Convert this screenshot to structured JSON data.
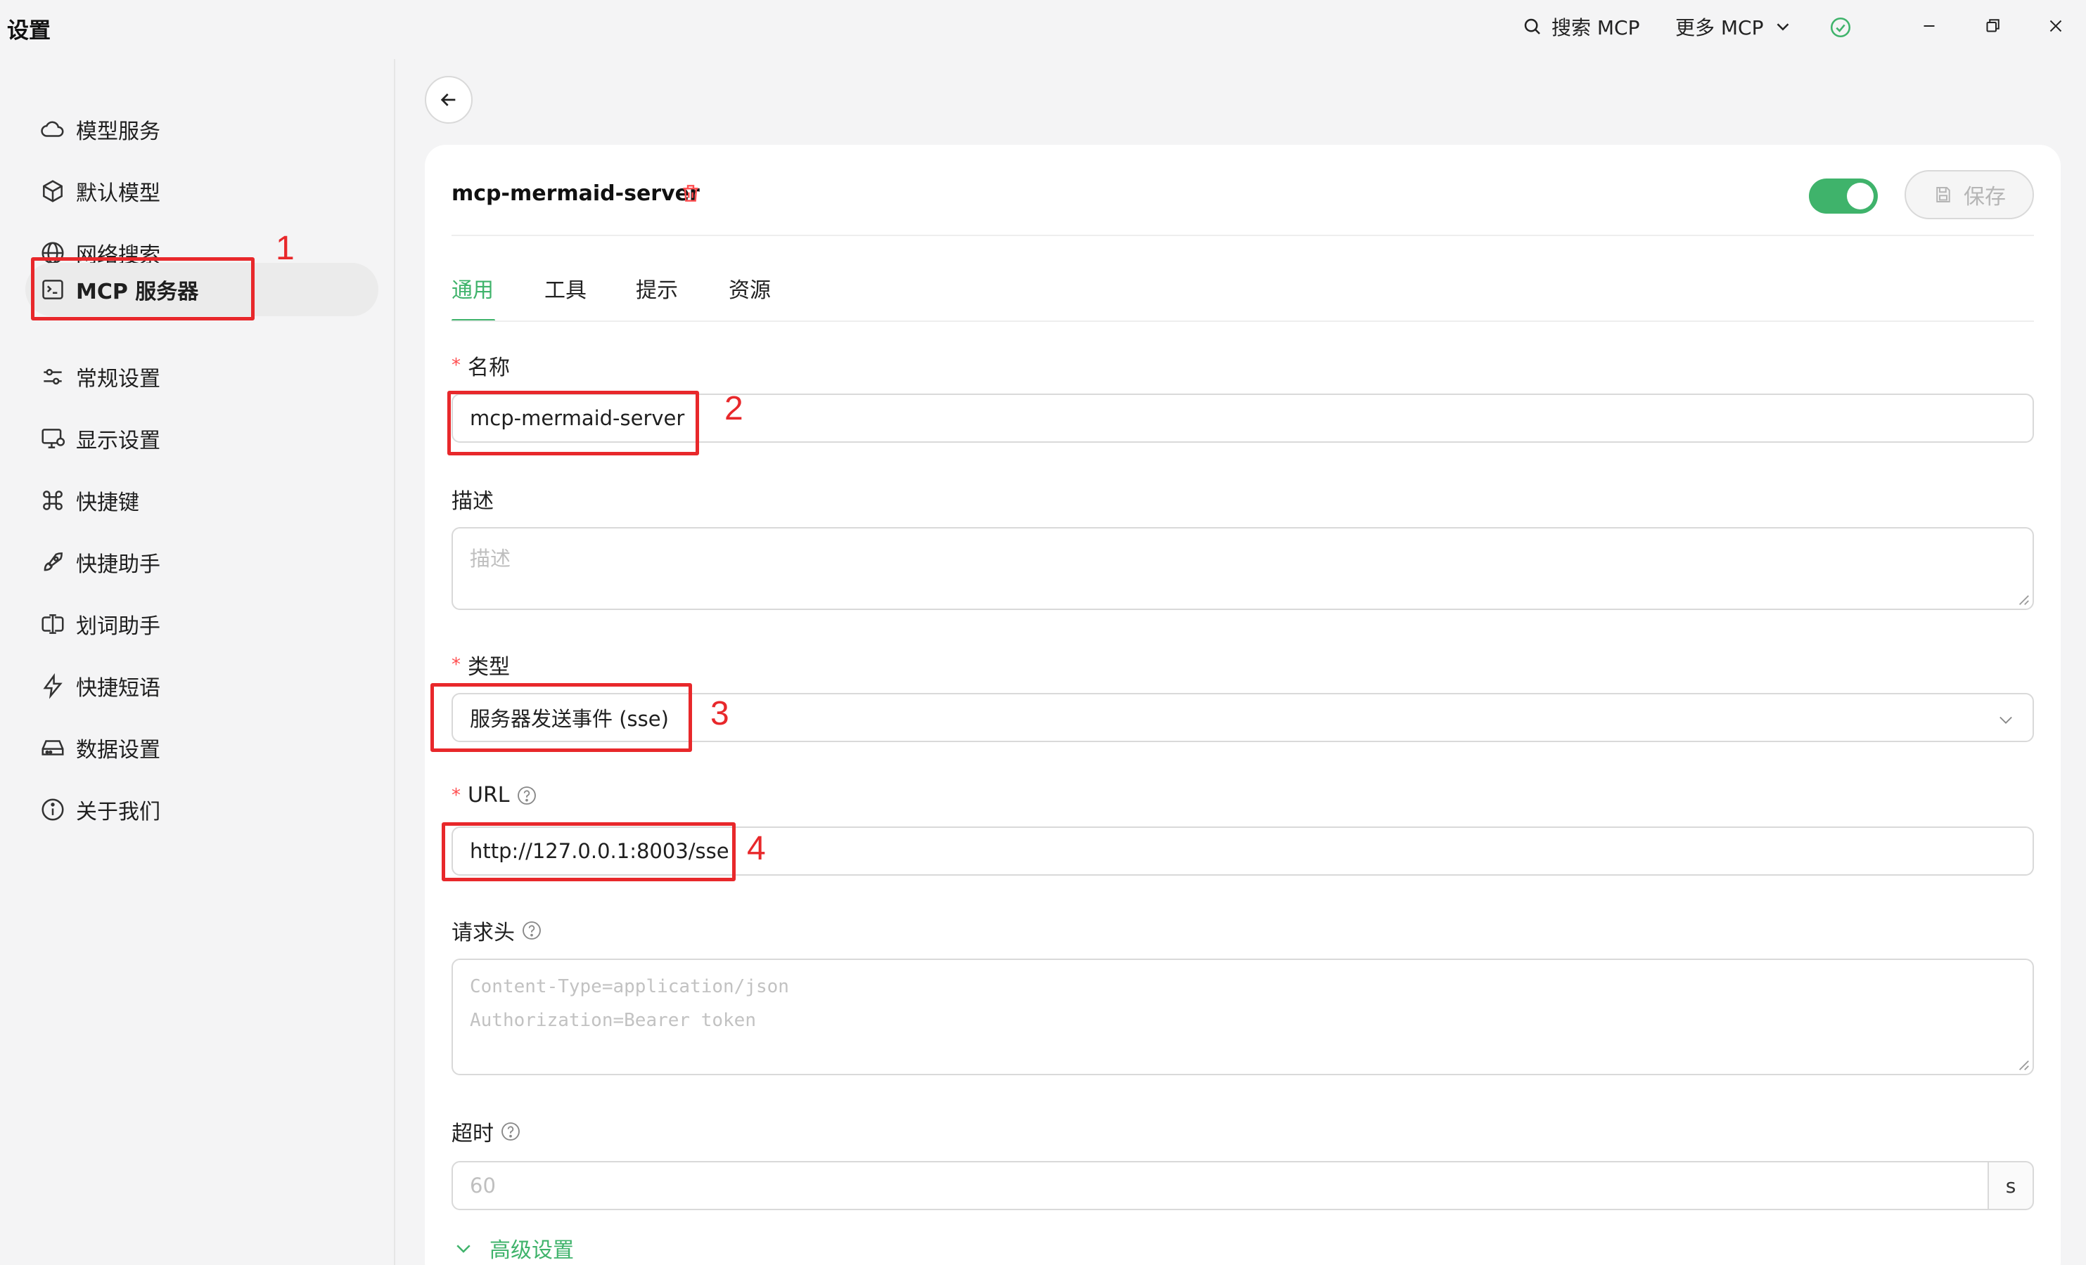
{
  "app": {
    "title": "设置"
  },
  "titlebar": {
    "search_mcp": "搜索 MCP",
    "more_mcp": "更多 MCP"
  },
  "sidebar": {
    "items": [
      {
        "label": "模型服务",
        "icon": "cloud-icon"
      },
      {
        "label": "默认模型",
        "icon": "cube-icon"
      },
      {
        "label": "网络搜索",
        "icon": "globe-icon"
      },
      {
        "label": "MCP 服务器",
        "icon": "terminal-icon",
        "active": true
      },
      {
        "label": "常规设置",
        "icon": "sliders-icon"
      },
      {
        "label": "显示设置",
        "icon": "monitor-icon"
      },
      {
        "label": "快捷键",
        "icon": "command-icon"
      },
      {
        "label": "快捷助手",
        "icon": "rocket-icon"
      },
      {
        "label": "划词助手",
        "icon": "text-cursor-icon"
      },
      {
        "label": "快捷短语",
        "icon": "zap-icon"
      },
      {
        "label": "数据设置",
        "icon": "hard-drive-icon"
      },
      {
        "label": "关于我们",
        "icon": "info-icon"
      }
    ]
  },
  "server": {
    "title": "mcp-mermaid-server",
    "enabled": true,
    "save_label": "保存"
  },
  "tabs": [
    "通用",
    "工具",
    "提示",
    "资源"
  ],
  "form": {
    "name_label": "名称",
    "name_value": "mcp-mermaid-server",
    "desc_label": "描述",
    "desc_placeholder": "描述",
    "type_label": "类型",
    "type_value": "服务器发送事件 (sse)",
    "url_label": "URL",
    "url_value": "http://127.0.0.1:8003/sse",
    "headers_label": "请求头",
    "headers_placeholder_1": "Content-Type=application/json",
    "headers_placeholder_2": "Authorization=Bearer token",
    "timeout_label": "超时",
    "timeout_placeholder": "60",
    "timeout_unit": "s",
    "advanced_label": "高级设置"
  },
  "annotations": [
    "1",
    "2",
    "3",
    "4"
  ],
  "colors": {
    "accent": "#3fb36b",
    "annotation": "#e8282b",
    "danger": "#ff4d4f"
  }
}
